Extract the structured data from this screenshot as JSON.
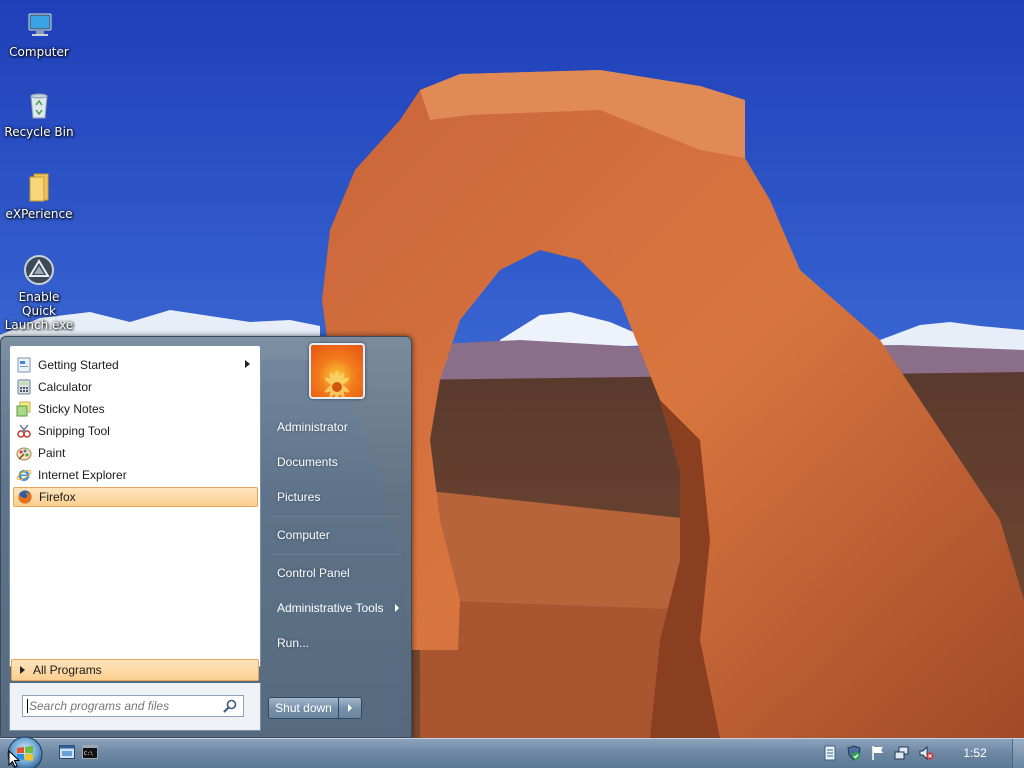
{
  "desktop": {
    "icons": [
      {
        "label": "Computer",
        "icon": "computer-icon"
      },
      {
        "label": "Recycle Bin",
        "icon": "recycle-bin-icon"
      },
      {
        "label": "eXPerience",
        "icon": "folder-icon"
      },
      {
        "label": "Enable Quick\nLaunch.exe",
        "icon": "exe-icon"
      }
    ]
  },
  "start_menu": {
    "programs": [
      {
        "label": "Getting Started",
        "icon": "getting-started-icon",
        "submenu": true
      },
      {
        "label": "Calculator",
        "icon": "calculator-icon"
      },
      {
        "label": "Sticky Notes",
        "icon": "sticky-notes-icon"
      },
      {
        "label": "Snipping Tool",
        "icon": "snipping-tool-icon"
      },
      {
        "label": "Paint",
        "icon": "paint-icon"
      },
      {
        "label": "Internet Explorer",
        "icon": "internet-explorer-icon"
      },
      {
        "label": "Firefox",
        "icon": "firefox-icon",
        "highlighted": true
      }
    ],
    "all_programs_label": "All Programs",
    "search_placeholder": "Search programs and files",
    "right_items": [
      {
        "label": "Administrator"
      },
      {
        "label": "Documents"
      },
      {
        "label": "Pictures"
      },
      {
        "label": "Computer"
      },
      {
        "label": "Control Panel"
      },
      {
        "label": "Administrative Tools",
        "submenu": true
      },
      {
        "label": "Run..."
      }
    ],
    "shutdown_label": "Shut down"
  },
  "taskbar": {
    "clock": "1:52",
    "pinned": [
      "explorer-window-icon",
      "command-prompt-icon"
    ],
    "tray": [
      "notepad-tray-icon",
      "security-tray-icon",
      "action-center-flag-icon",
      "network-icon",
      "volume-muted-icon"
    ]
  },
  "colors": {
    "highlight_top": "#fde4bd",
    "highlight_bottom": "#fbcf8f",
    "start_menu_glass": "#6f89a5",
    "sky": "#2a4fc0"
  }
}
